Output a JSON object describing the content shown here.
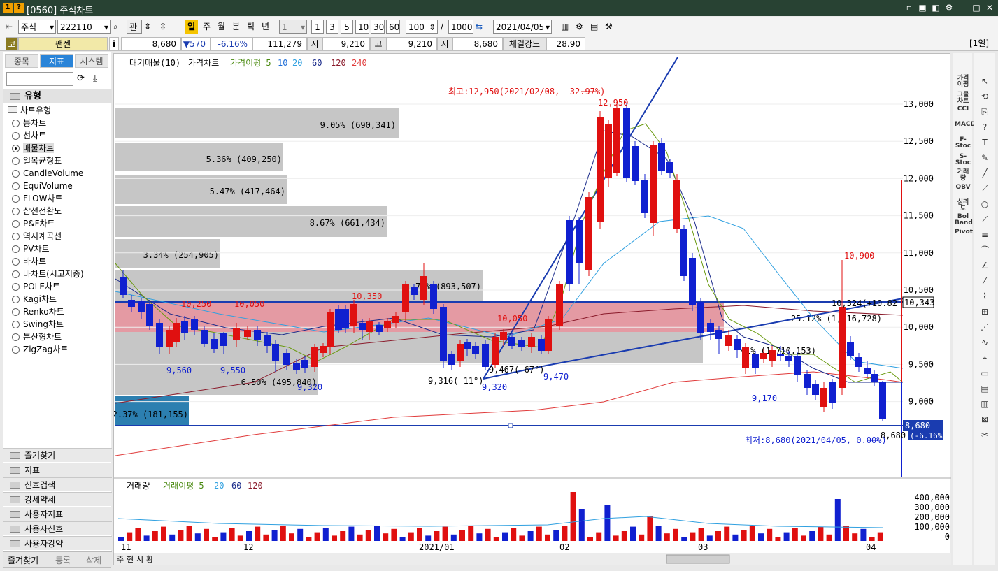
{
  "window": {
    "badge1": "1",
    "badge2": "?",
    "title": "[0560] 주식차트"
  },
  "toolbar": {
    "market": "주식",
    "code": "222110",
    "btn_gwan": "관",
    "periods": [
      "일",
      "주",
      "월",
      "분",
      "틱",
      "년"
    ],
    "active_period": "일",
    "period_count": "1",
    "quick": [
      "1",
      "3",
      "5",
      "10",
      "30",
      "60"
    ],
    "display_count": "100",
    "slash": "/",
    "total_count": "1000",
    "date": "2021/04/05"
  },
  "info": {
    "code_tag": "코",
    "name": "팬젠",
    "i_btn": "i",
    "price": "8,680",
    "change": "▼570",
    "rate": "-6.16%",
    "volume": "111,279",
    "open_lbl": "시",
    "open": "9,210",
    "high_lbl": "고",
    "high": "9,210",
    "low_lbl": "저",
    "low": "8,680",
    "strength_lbl": "체결강도",
    "strength": "28.90",
    "period_tag": "[1일]"
  },
  "sidebar": {
    "tabs": [
      "종목",
      "지표",
      "시스템"
    ],
    "active_tab": "지표",
    "section": "유형",
    "group": "차트유형",
    "chart_types": [
      "봉차트",
      "선차트",
      "매물차트",
      "일목균형표",
      "CandleVolume",
      "EquiVolume",
      "FLOW차트",
      "삼선전환도",
      "P&F차트",
      "역시계곡선",
      "PV차트",
      "바차트",
      "바차트(시고저종)",
      "POLE차트",
      "Kagi차트",
      "Renko차트",
      "Swing차트",
      "분산형차트",
      "ZigZag차트"
    ],
    "selected": "매물차트",
    "menus": [
      "즐겨찾기",
      "지표",
      "신호검색",
      "강세약세",
      "사용자지표",
      "사용자신호",
      "사용자강약"
    ],
    "bottom_tabs": [
      "즐겨찾기",
      "등록",
      "삭제"
    ]
  },
  "chart": {
    "legend": {
      "prefix": "대기매물(10)",
      "series_main": "가격차트",
      "ma_label": "가격이평 5",
      "ma": [
        {
          "n": "10",
          "color": "#1f6ed8"
        },
        {
          "n": "20",
          "color": "#2fa0e0"
        },
        {
          "n": "60",
          "color": "#1a2a8a"
        },
        {
          "n": "120",
          "color": "#8a1a2a"
        },
        {
          "n": "240",
          "color": "#e03a3a"
        }
      ]
    },
    "y_ticks": [
      "13,000",
      "12,500",
      "12,000",
      "11,500",
      "11,000",
      "10,500",
      "10,000",
      "9,500",
      "9,000"
    ],
    "x_ticks": [
      "11",
      "12",
      "2021/01",
      "02",
      "03",
      "04"
    ],
    "high_note": "최고:12,950(2021/02/08, -32.97%)",
    "low_note": "최저:8,680(2021/04/05, 0.00%)",
    "price_tag": "8,680",
    "rate_tag": "(-6.16%)",
    "line_tag": "10,343",
    "vp_labels": [
      "9.05% (690,341)",
      "5.36% (409,250)",
      "5.47% (417,464)",
      "8.67% (661,434)",
      "3.34% (254,905)",
      "71% (893,507)",
      "25.12% (1,916,728)",
      "41% (1,710,153)",
      "6.50% (495,840)",
      "2.37% (181,155)"
    ],
    "annotations": [
      "12,950",
      "10,900",
      "10,350",
      "10,050",
      "10,050",
      "9,560",
      "9,550",
      "9,320",
      "9,320",
      "9,470",
      "9,170",
      "8,680",
      "10,250",
      "9,316( 11°)",
      "9,467( 67°)",
      "10,324(+10.82 %)"
    ],
    "volume": {
      "legend_a": "거래량",
      "legend_b": "거래이평 5",
      "legend_ma": [
        {
          "n": "20",
          "color": "#2fa0e0"
        },
        {
          "n": "60",
          "color": "#1a2a8a"
        },
        {
          "n": "120",
          "color": "#8a1a2a"
        }
      ],
      "ticks": [
        "400,000",
        "300,000",
        "200,000",
        "100,000",
        "0"
      ]
    },
    "bottom": {
      "tabs": [
        "주",
        "현",
        "시",
        "황"
      ]
    }
  },
  "right_tools": [
    "가격이평",
    "그물차트",
    "CCI",
    "MACD",
    "F-Stoc",
    "S-Stoc",
    "거래량",
    "OBV",
    "심리도",
    "Bol Band",
    "Pivot"
  ],
  "chart_data": {
    "type": "candlestick",
    "x_label": "",
    "y_range": [
      8500,
      13300
    ],
    "max_price": 12950,
    "min_price": 8680,
    "last": 8680
  }
}
